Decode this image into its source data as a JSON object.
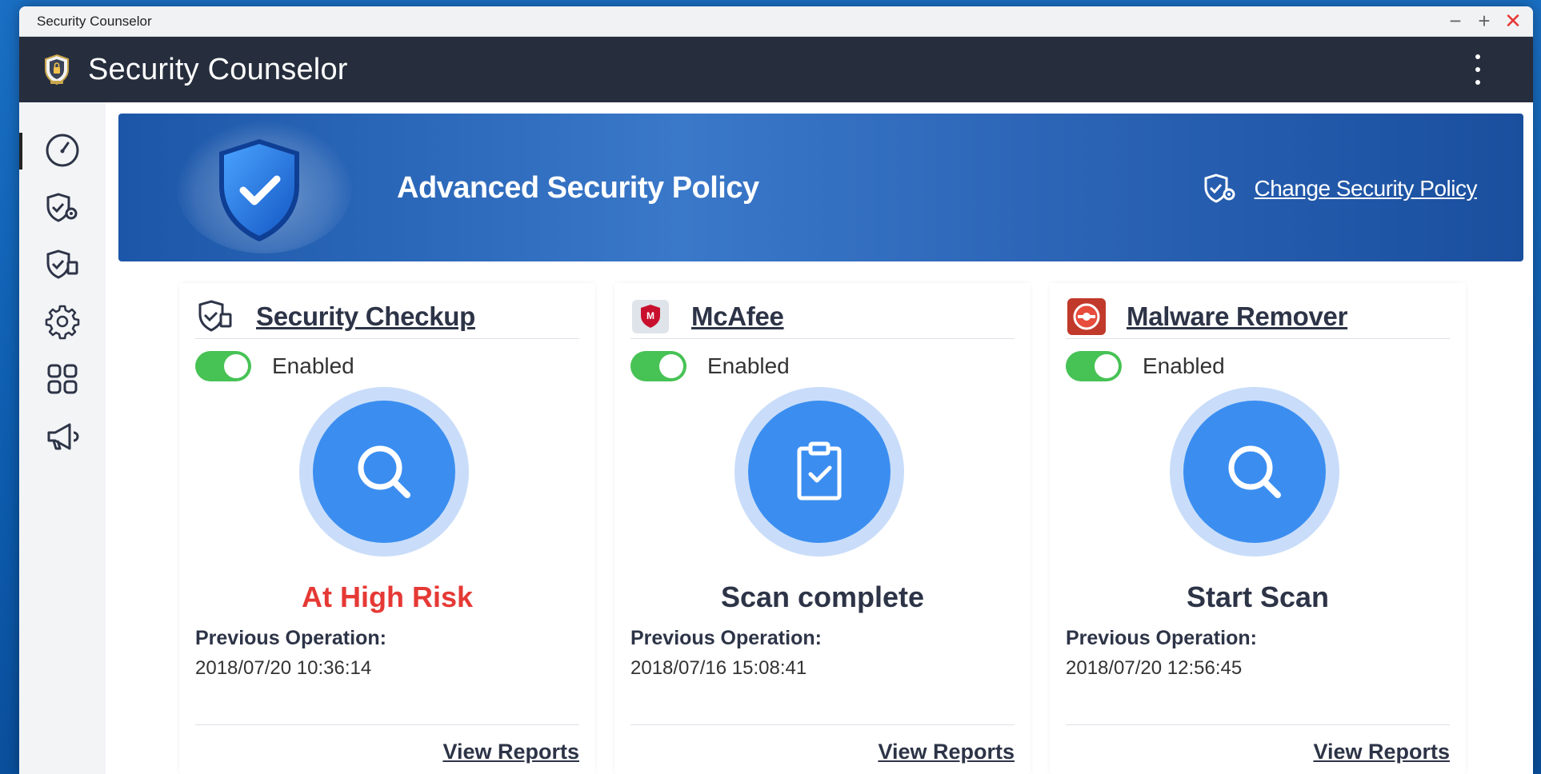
{
  "window": {
    "title": "Security Counselor",
    "controls": {
      "minimize": "−",
      "maximize": "+",
      "close": "✕"
    }
  },
  "app": {
    "title": "Security Counselor",
    "logo_icon": "shield-badge-icon",
    "menu_icon": "more-vertical-icon"
  },
  "sidebar": {
    "items": [
      {
        "name": "dashboard",
        "icon": "speedometer-icon",
        "active": true
      },
      {
        "name": "security-policy",
        "icon": "shield-gear-icon",
        "active": false
      },
      {
        "name": "security-checkup",
        "icon": "shield-report-icon",
        "active": false
      },
      {
        "name": "settings",
        "icon": "gear-icon",
        "active": false
      },
      {
        "name": "apps",
        "icon": "apps-grid-icon",
        "active": false
      },
      {
        "name": "announcements",
        "icon": "megaphone-icon",
        "active": false
      }
    ]
  },
  "banner": {
    "policy_title": "Advanced Security Policy",
    "change_link": "Change Security Policy"
  },
  "cards": [
    {
      "title": "Security Checkup",
      "icon": "shield-report-icon",
      "toggle_label": "Enabled",
      "enabled": true,
      "action_icon": "magnifier-icon",
      "status": "At High Risk",
      "status_color": "#e53935",
      "prev_label": "Previous Operation:",
      "prev_time": "2018/07/20 10:36:14",
      "reports_link": "View Reports"
    },
    {
      "title": "McAfee",
      "icon": "mcafee-shield-icon",
      "toggle_label": "Enabled",
      "enabled": true,
      "action_icon": "clipboard-check-icon",
      "status": "Scan complete",
      "status_color": "#2d3447",
      "prev_label": "Previous Operation:",
      "prev_time": "2018/07/16 15:08:41",
      "reports_link": "View Reports"
    },
    {
      "title": "Malware Remover",
      "icon": "malware-remover-icon",
      "toggle_label": "Enabled",
      "enabled": true,
      "action_icon": "magnifier-icon",
      "status": "Start Scan",
      "status_color": "#2d3447",
      "prev_label": "Previous Operation:",
      "prev_time": "2018/07/20 12:56:45",
      "reports_link": "View Reports"
    }
  ],
  "colors": {
    "accent_blue": "#3b8ef0",
    "toggle_on": "#47c255",
    "header_dark": "#262d3d",
    "risk_red": "#e53935"
  }
}
